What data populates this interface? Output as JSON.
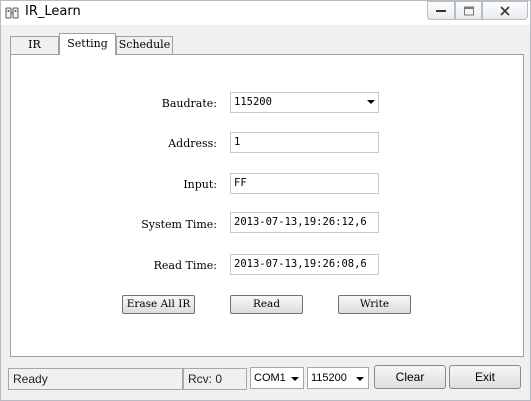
{
  "window": {
    "title": "IR_Learn",
    "icon": "app-icon"
  },
  "tabs": [
    {
      "label": "IR",
      "active": false
    },
    {
      "label": "Setting",
      "active": true
    },
    {
      "label": "Schedule",
      "active": false
    }
  ],
  "setting": {
    "baudrate": {
      "label": "Baudrate:",
      "value": "115200"
    },
    "address": {
      "label": "Address:",
      "value": "1"
    },
    "input": {
      "label": "Input:",
      "value": "FF"
    },
    "system_time": {
      "label": "System Time:",
      "value": "2013-07-13,19:26:12,6"
    },
    "read_time": {
      "label": "Read Time:",
      "value": "2013-07-13,19:26:08,6"
    },
    "buttons": {
      "erase_all": "Erase All IR",
      "read": "Read",
      "write": "Write"
    }
  },
  "status": {
    "ready": "Ready",
    "rcv": "Rcv: 0",
    "com_port": "COM1",
    "baud": "115200",
    "clear_label": "Clear",
    "exit_label": "Exit"
  }
}
